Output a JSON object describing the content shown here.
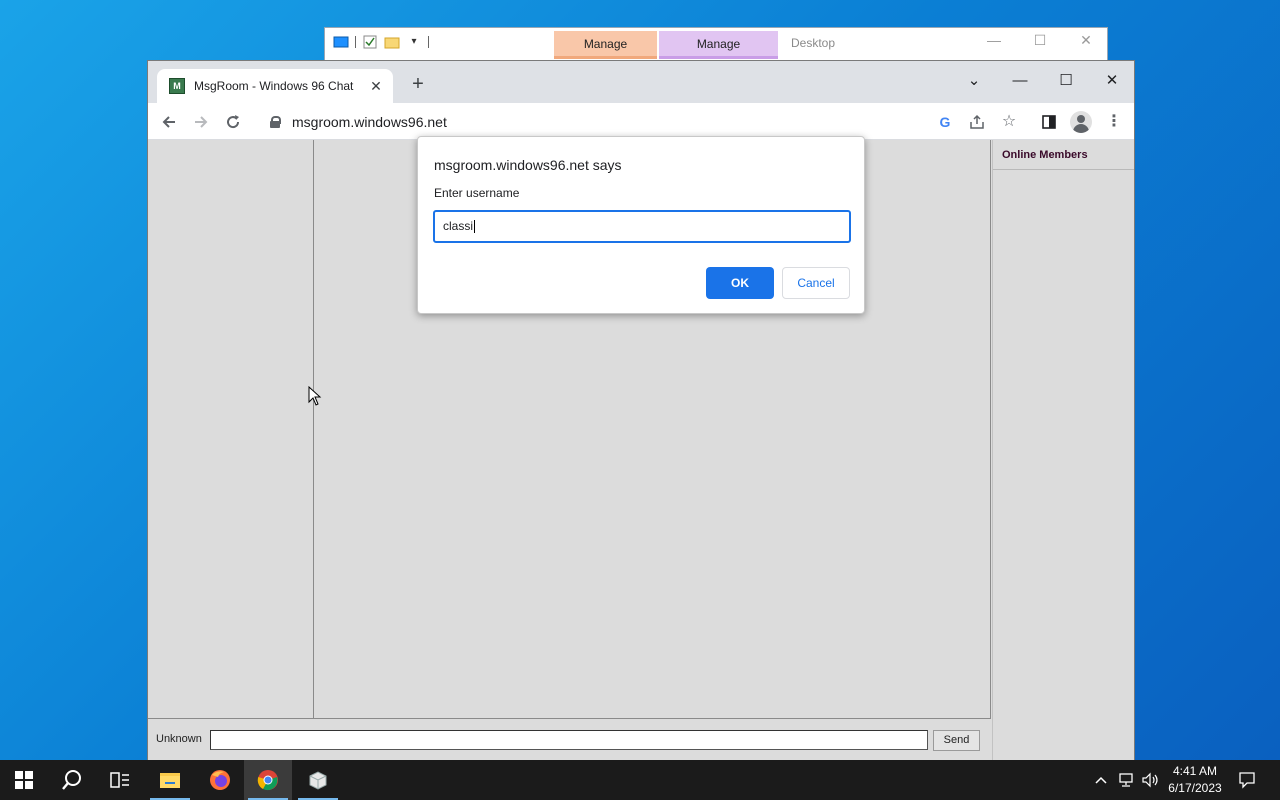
{
  "explorer": {
    "ctx_tab_1": "Manage",
    "ctx_tab_2": "Manage",
    "title": "Desktop"
  },
  "browser": {
    "tab_title": "MsgRoom - Windows 96 Chat",
    "url": "msgroom.windows96.net"
  },
  "dialog": {
    "title": "msgroom.windows96.net says",
    "message": "Enter username",
    "input_value": "classi",
    "ok_label": "OK",
    "cancel_label": "Cancel"
  },
  "chat": {
    "members_header": "Online Members",
    "nickname": "Unknown",
    "send_label": "Send"
  },
  "taskbar": {
    "time": "4:41 AM",
    "date": "6/17/2023"
  },
  "colors": {
    "accent": "#1a73e8",
    "desktop": "#0b7fd4",
    "taskbar": "#1b1b1b"
  }
}
